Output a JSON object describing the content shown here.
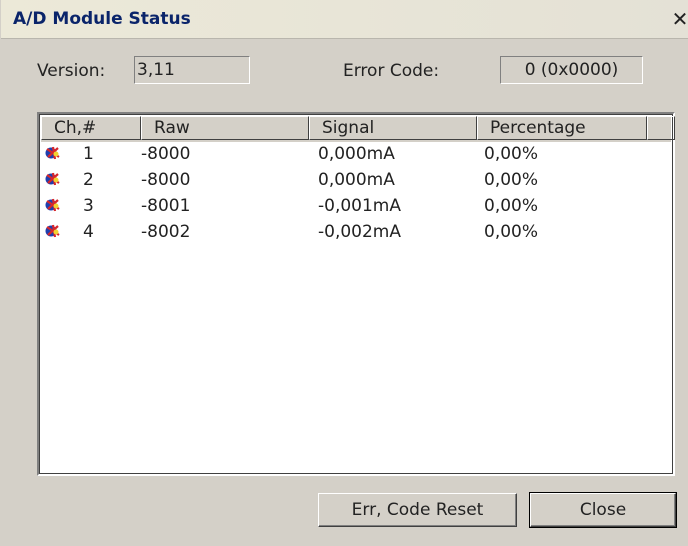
{
  "window": {
    "title": "A/D Module Status"
  },
  "version": {
    "label": "Version:",
    "value": "3,11"
  },
  "error_code": {
    "label": "Error Code:",
    "value": "0 (0x0000)"
  },
  "table": {
    "columns": [
      "Ch,#",
      "Raw",
      "Signal",
      "Percentage"
    ],
    "rows": [
      {
        "ch": "1",
        "raw": "-8000",
        "signal": "0,000mA",
        "percentage": "0,00%"
      },
      {
        "ch": "2",
        "raw": "-8000",
        "signal": "0,000mA",
        "percentage": "0,00%"
      },
      {
        "ch": "3",
        "raw": "-8001",
        "signal": "-0,001mA",
        "percentage": "0,00%"
      },
      {
        "ch": "4",
        "raw": "-8002",
        "signal": "-0,002mA",
        "percentage": "0,00%"
      }
    ],
    "row_icon": "channel-icon"
  },
  "buttons": {
    "reset": "Err, Code Reset",
    "close": "Close"
  }
}
